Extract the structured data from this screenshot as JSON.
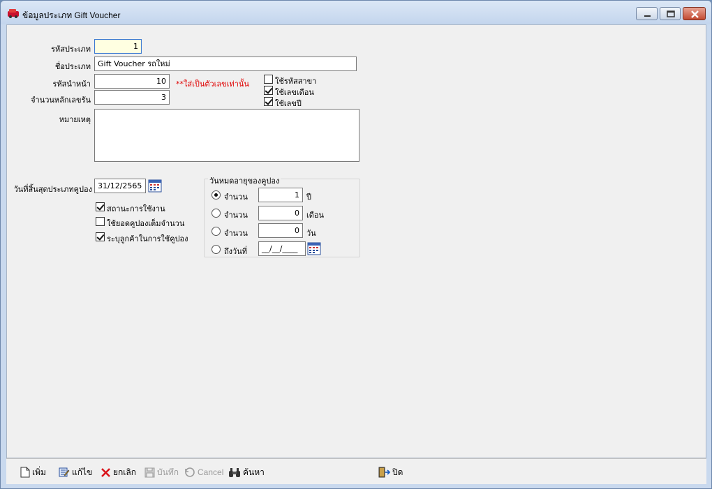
{
  "window": {
    "title": "ข้อมูลประเภท Gift Voucher"
  },
  "form": {
    "type_code_label": "รหัสประเภท",
    "type_code_value": "1",
    "type_name_label": "ชื่อประเภท",
    "type_name_value": "Gift Voucher รถใหม่",
    "prefix_label": "รหัสนำหน้า",
    "prefix_value": "10",
    "prefix_note": "**ใส่เป็นตัวเลขเท่านั้น",
    "running_digits_label": "จำนวนหลักเลขรัน",
    "running_digits_value": "3",
    "remark_label": "หมายเหตุ",
    "remark_value": "",
    "use_branch_code": {
      "label": "ใช้รหัสสาขา",
      "checked": false
    },
    "use_month": {
      "label": "ใช้เลขเดือน",
      "checked": true
    },
    "use_year": {
      "label": "ใช้เลขปี",
      "checked": true
    },
    "end_date_label": "วันที่สิ้นสุดประเภทคูปอง",
    "end_date_value": "31/12/2565",
    "status_active": {
      "label": "สถานะการใช้งาน",
      "checked": true
    },
    "use_full_amount": {
      "label": "ใช้ยอดคูปองเต็มจำนวน",
      "checked": false
    },
    "specify_customer": {
      "label": "ระบุลูกค้าในการใช้คูปอง",
      "checked": true
    }
  },
  "expiry_group": {
    "title": "วันหมดอายุของคูปอง",
    "options": [
      {
        "label": "จำนวน",
        "value": "1",
        "unit": "ปี",
        "selected": true
      },
      {
        "label": "จำนวน",
        "value": "0",
        "unit": "เดือน",
        "selected": false
      },
      {
        "label": "จำนวน",
        "value": "0",
        "unit": "วัน",
        "selected": false
      },
      {
        "label": "ถึงวันที่",
        "value": "__/__/____",
        "unit": "",
        "selected": false
      }
    ]
  },
  "toolbar": {
    "add": "เพิ่ม",
    "edit": "แก้ไข",
    "delete": "ยกเลิก",
    "save": "บันทึก",
    "cancel": "Cancel",
    "search": "ค้นหา",
    "close": "ปิด"
  },
  "colors": {
    "note_red": "#e00000",
    "field_highlight": "#ffffe1"
  }
}
